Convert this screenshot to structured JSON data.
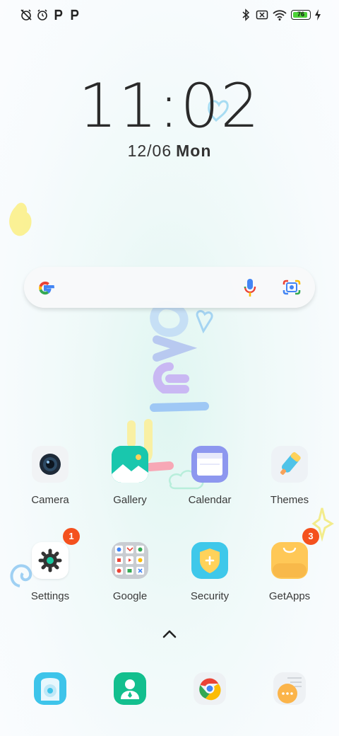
{
  "status_bar": {
    "left_icons": [
      "alarm-off-icon",
      "alarm-clock-icon",
      "p-app-icon",
      "p-app-icon"
    ],
    "right_icons": [
      "bluetooth-icon",
      "no-sim-icon",
      "wifi-icon",
      "battery-icon",
      "charging-icon"
    ],
    "battery_percent": "76"
  },
  "clock": {
    "time": "11:02",
    "date": "12/06",
    "weekday": "Mon"
  },
  "search_bar": {
    "logo": "G",
    "voice_icon": "mic-icon",
    "lens_icon": "google-lens-icon"
  },
  "apps": [
    {
      "label": "Camera",
      "icon": "camera-icon"
    },
    {
      "label": "Gallery",
      "icon": "gallery-icon"
    },
    {
      "label": "Calendar",
      "icon": "calendar-icon"
    },
    {
      "label": "Themes",
      "icon": "themes-icon"
    },
    {
      "label": "Settings",
      "icon": "settings-gear-icon",
      "badge": "1"
    },
    {
      "label": "Google",
      "icon": "google-folder-icon"
    },
    {
      "label": "Security",
      "icon": "security-shield-icon"
    },
    {
      "label": "GetApps",
      "icon": "getapps-bag-icon",
      "badge": "3"
    }
  ],
  "dock": [
    {
      "icon": "phone-dialer-icon"
    },
    {
      "icon": "contacts-icon"
    },
    {
      "icon": "chrome-icon"
    },
    {
      "icon": "messages-icon"
    }
  ],
  "wallpaper_text": "lovely",
  "colors": {
    "badge": "#f4511e",
    "battery": "#4cd137",
    "accent_teal": "#17c39b"
  }
}
